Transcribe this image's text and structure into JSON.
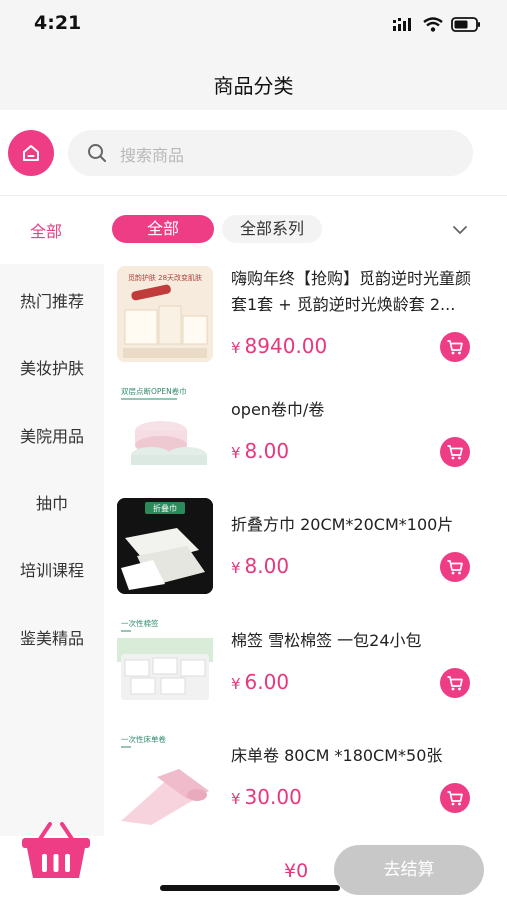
{
  "status": {
    "time": "4:21"
  },
  "nav": {
    "title": "商品分类"
  },
  "search": {
    "placeholder": "搜索商品"
  },
  "filter": {
    "left_label": "全部",
    "chips": [
      "全部",
      "全部系列"
    ]
  },
  "sidebar": {
    "items": [
      "热门推荐",
      "美妆护肤",
      "美院用品",
      "抽巾",
      "培训课程",
      "鉴美精品"
    ]
  },
  "products": [
    {
      "name": "嗨购年终【抢购】觅韵逆时光童颜套1套 + 觅韵逆时光焕龄套 2...",
      "currency": "¥",
      "price": "8940.00",
      "thumb_text": "觅韵护肤 28天改变肌肤"
    },
    {
      "name": "open卷巾/卷",
      "currency": "¥",
      "price": "8.00",
      "thumb_text": "双层点断OPEN卷巾"
    },
    {
      "name": "折叠方巾 20CM*20CM*100片",
      "currency": "¥",
      "price": "8.00",
      "thumb_text": "折叠巾"
    },
    {
      "name": "棉签 雪松棉签 一包24小包",
      "currency": "¥",
      "price": "6.00",
      "thumb_text": "一次性棉签"
    },
    {
      "name": "床单卷 80CM *180CM*50张",
      "currency": "¥",
      "price": "30.00",
      "thumb_text": "一次性床单卷"
    }
  ],
  "footer": {
    "total": "¥0",
    "checkout_label": "去结算"
  },
  "colors": {
    "accent": "#ee3d85",
    "price": "#e8377f",
    "checkout_disabled": "#c8c8c8"
  }
}
